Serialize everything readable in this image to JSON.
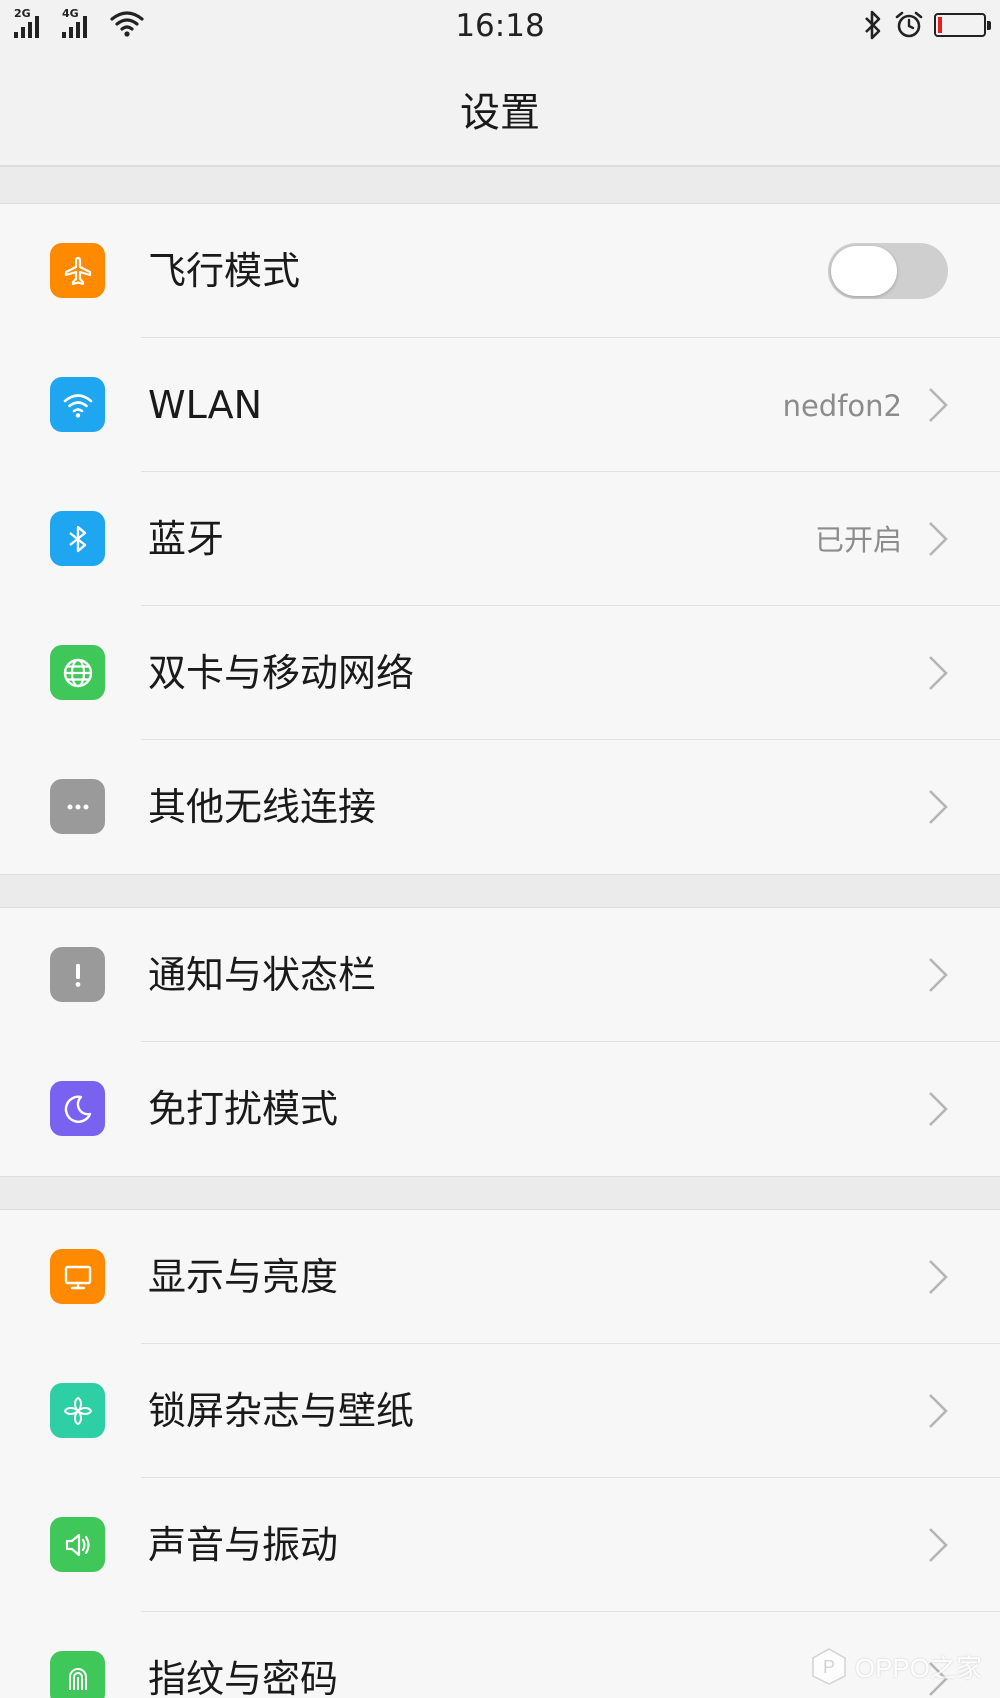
{
  "status_bar": {
    "network_1": "2G",
    "network_2": "4G",
    "time": "16:18",
    "battery_level_percent": 10,
    "icons": [
      "signal-icon",
      "signal-icon",
      "wifi-icon",
      "bluetooth-icon",
      "alarm-icon",
      "battery-icon"
    ]
  },
  "header": {
    "title": "设置"
  },
  "sections": [
    {
      "items": [
        {
          "label": "飞行模式",
          "icon": "airplane-icon",
          "icon_color": "#ff8a00",
          "control": "toggle",
          "toggle_on": false
        },
        {
          "label": "WLAN",
          "icon": "wifi-icon",
          "icon_color": "#1ea7f0",
          "value": "nedfon2",
          "control": "chevron"
        },
        {
          "label": "蓝牙",
          "icon": "bluetooth-icon",
          "icon_color": "#1ea7f0",
          "value": "已开启",
          "control": "chevron"
        },
        {
          "label": "双卡与移动网络",
          "icon": "globe-icon",
          "icon_color": "#3fc75a",
          "control": "chevron"
        },
        {
          "label": "其他无线连接",
          "icon": "more-icon",
          "icon_color": "#9a9a9a",
          "control": "chevron"
        }
      ]
    },
    {
      "items": [
        {
          "label": "通知与状态栏",
          "icon": "exclamation-icon",
          "icon_color": "#9a9a9a",
          "control": "chevron"
        },
        {
          "label": "免打扰模式",
          "icon": "moon-icon",
          "icon_color": "#7a62f0",
          "control": "chevron"
        }
      ]
    },
    {
      "items": [
        {
          "label": "显示与亮度",
          "icon": "monitor-icon",
          "icon_color": "#ff8a00",
          "control": "chevron"
        },
        {
          "label": "锁屏杂志与壁纸",
          "icon": "pinwheel-icon",
          "icon_color": "#2ecfa5",
          "control": "chevron"
        },
        {
          "label": "声音与振动",
          "icon": "speaker-icon",
          "icon_color": "#3fc75a",
          "control": "chevron"
        },
        {
          "label": "指纹与密码",
          "icon": "fingerprint-icon",
          "icon_color": "#3fc75a",
          "control": "chevron"
        }
      ]
    }
  ],
  "watermark": {
    "text": "OPPO之家"
  }
}
